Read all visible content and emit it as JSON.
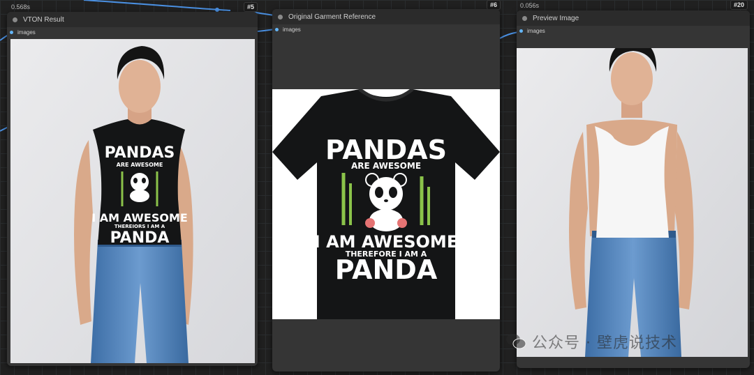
{
  "nodes": [
    {
      "id": "#5",
      "title": "VTON Result",
      "output": "images",
      "timing": "0.568s"
    },
    {
      "id": "#6",
      "title": "Original Garment Reference",
      "output": "images",
      "timing": ""
    },
    {
      "id": "#20",
      "title": "Preview Image",
      "output": "images",
      "timing": "0.056s"
    }
  ],
  "shirt_print": {
    "line1": "PANDAS",
    "line2": "ARE AWESOME",
    "line3": "I AM AWESOME",
    "line4": "THEREFORE I AM A",
    "line5": "PANDA",
    "vton_line4": "THEREIORS I AM A"
  },
  "watermark": {
    "text": "公众号 · 壁虎说技术",
    "icon": "wechat-icon"
  },
  "colors": {
    "canvas": "#202020",
    "node_body": "#353535",
    "node_title": "#2b2b2b",
    "link": "#64b5f6",
    "tshirt": "#141516",
    "bamboo": "#8bc34a"
  }
}
